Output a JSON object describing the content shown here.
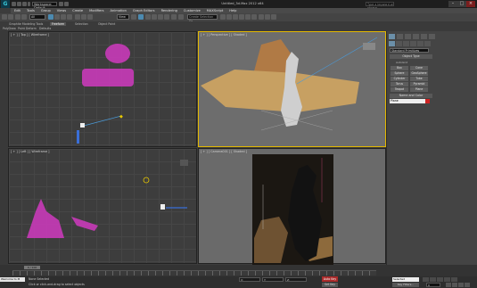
{
  "titlebar": {
    "logo": "G",
    "workspace": "Workspace: Default",
    "window_title": "Untitled_3d.Max 2012 x64",
    "search_placeholder": "Type a keyword or phrase",
    "min": "–",
    "max": "□",
    "close": "×"
  },
  "menu": [
    "Edit",
    "Tools",
    "Group",
    "Views",
    "Create",
    "Modifiers",
    "Animation",
    "Graph Editors",
    "Rendering",
    "Customize",
    "MAXScript",
    "Help"
  ],
  "toolbar": {
    "selection_filter": "All",
    "ref_coord": "View",
    "named_selection": "Create Selection Se"
  },
  "ribbon": {
    "tabs": [
      "Graphite Modeling Tools",
      "Freeform",
      "Selection",
      "Object Paint"
    ],
    "active_tab": "Freeform",
    "subtabs": [
      "PolyDraw",
      "Paint Deform",
      "Defaults"
    ]
  },
  "viewports": {
    "top": "[ + ] [ Top ] [ Wireframe ]",
    "perspective": "[ + ] [ Perspective ] [ Shaded ]",
    "left": "[ + ] [ Left ] [ Wireframe ]",
    "camera": "[ + ] [ Camera001 ] [ Shaded ]"
  },
  "command_panel": {
    "category": "Standard Primitives",
    "object_type_title": "Object Type",
    "autogrid": "AutoGrid",
    "buttons": [
      "Box",
      "Cone",
      "Sphere",
      "GeoSphere",
      "Cylinder",
      "Tube",
      "Torus",
      "Pyramid",
      "Teapot",
      "Plane"
    ],
    "name_color_title": "Name and Color",
    "name_value": "Plane"
  },
  "timeline": {
    "slider": "0 / 100",
    "ticks": [
      "0",
      "10",
      "20",
      "30",
      "40",
      "50",
      "60",
      "70",
      "80",
      "90",
      "100"
    ]
  },
  "status": {
    "maxscript": "Welcome to M",
    "message": "None Selected",
    "prompt": "Click or click-and-drag to select objects",
    "x": "X:",
    "y": "Y:",
    "z": "Z:",
    "autokey": "Auto Key",
    "setkey": "Set Key",
    "selected": "Selected",
    "key_filters": "Key Filters...",
    "frame": "0"
  },
  "colors": {
    "accent": "#e3b800",
    "selection_magenta": "#d02cb8",
    "autokey_red": "#aa2b2b"
  }
}
